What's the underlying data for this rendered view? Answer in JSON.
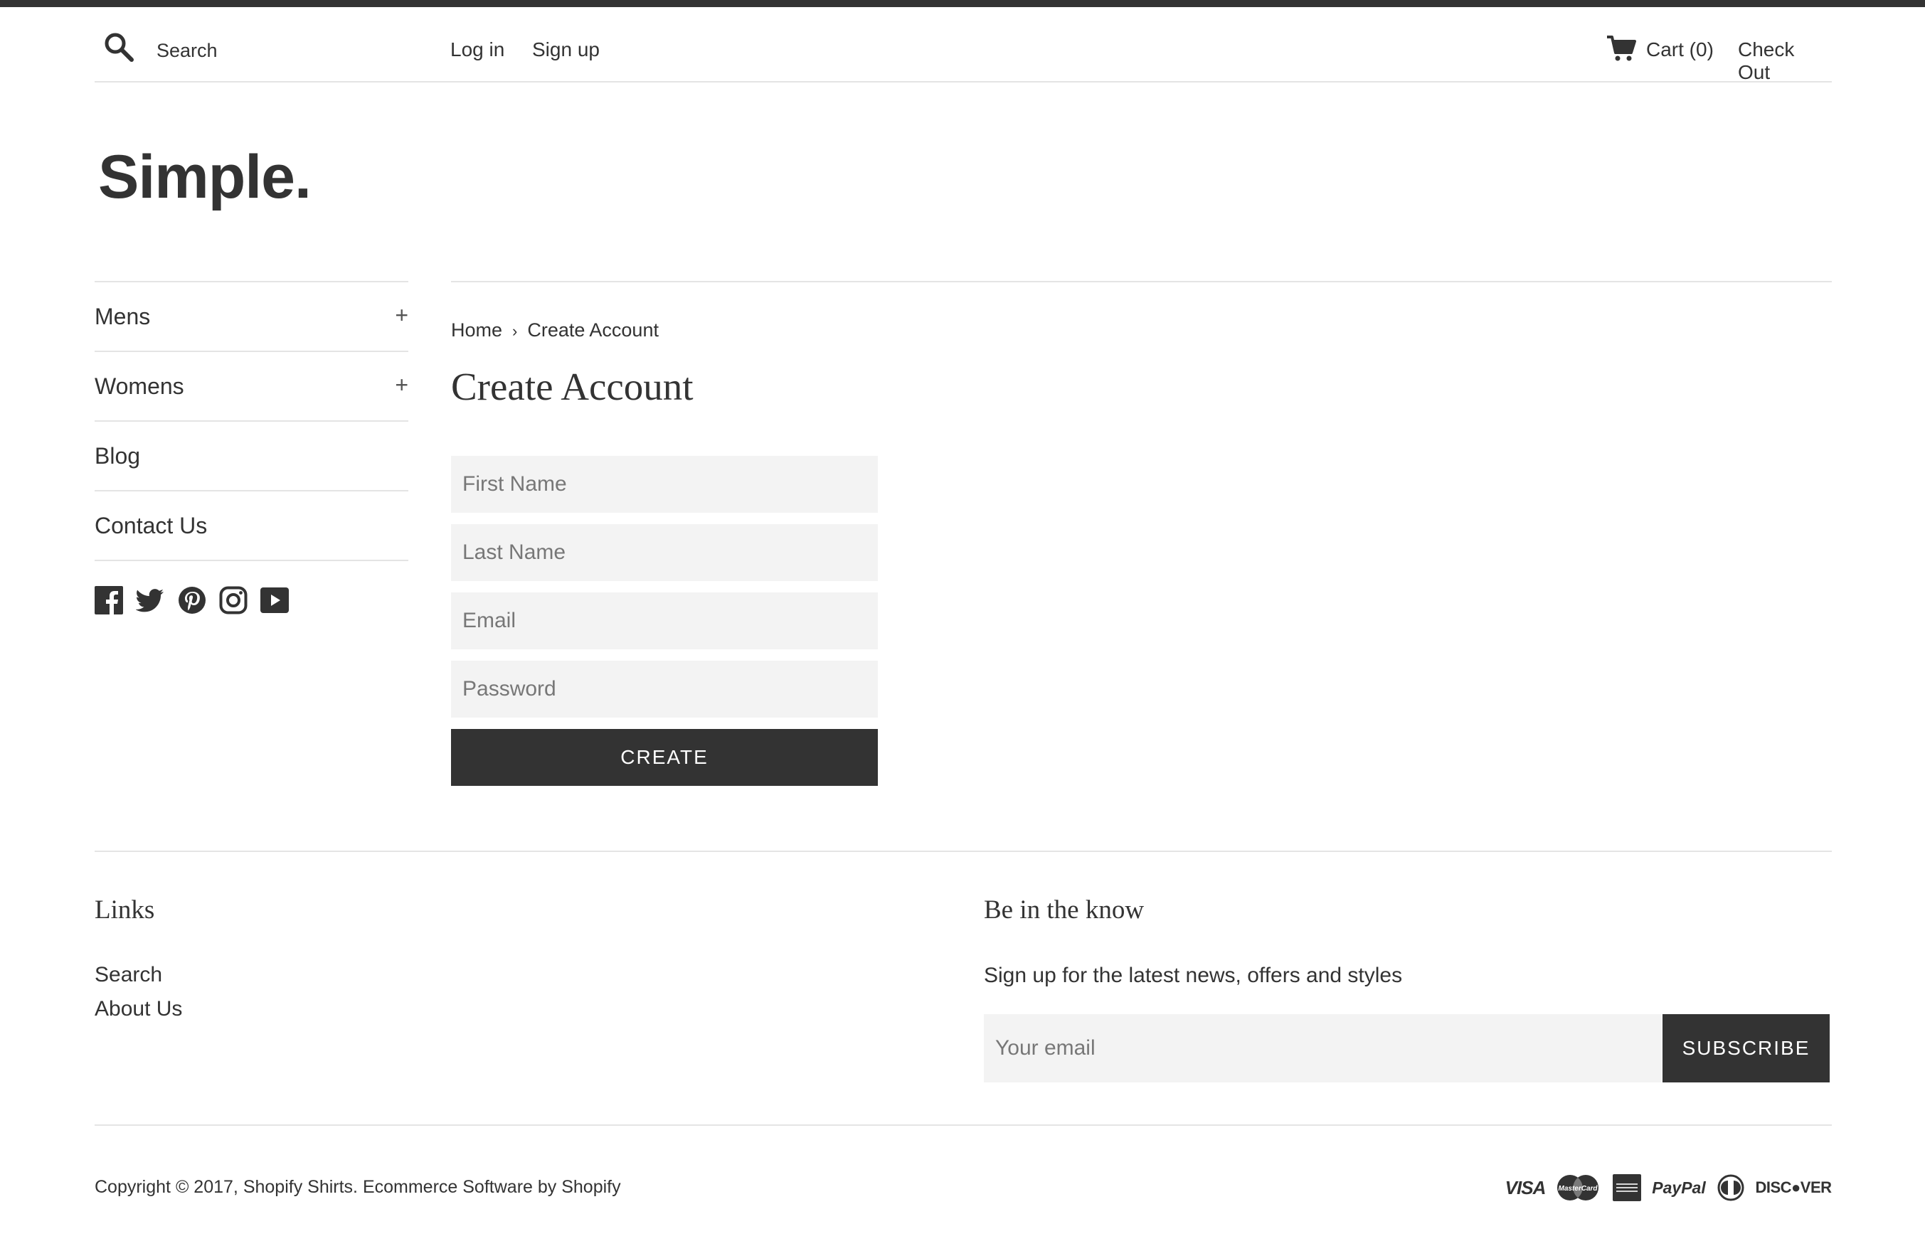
{
  "header": {
    "search_label": "Search",
    "login": "Log in",
    "signup": "Sign up",
    "cart": "Cart (0)",
    "checkout": "Check Out"
  },
  "logo": "Simple.",
  "sidebar": {
    "items": [
      {
        "label": "Mens",
        "expand": "+"
      },
      {
        "label": "Womens",
        "expand": "+"
      },
      {
        "label": "Blog"
      },
      {
        "label": "Contact Us"
      }
    ],
    "social_icons": [
      "facebook-icon",
      "twitter-icon",
      "pinterest-icon",
      "instagram-icon",
      "youtube-icon"
    ]
  },
  "breadcrumb": {
    "home": "Home",
    "separator": "›",
    "current": "Create Account"
  },
  "form": {
    "title": "Create Account",
    "first_name_placeholder": "First Name",
    "last_name_placeholder": "Last Name",
    "email_placeholder": "Email",
    "password_placeholder": "Password",
    "submit": "CREATE"
  },
  "footer": {
    "links_title": "Links",
    "links": [
      "Search",
      "About Us"
    ],
    "newsletter_title": "Be in the know",
    "newsletter_text": "Sign up for the latest news, offers and styles",
    "email_placeholder": "Your email",
    "subscribe": "SUBSCRIBE",
    "copyright": "Copyright © 2017, Shopify Shirts.",
    "powered_by": "Ecommerce Software by Shopify",
    "payment": {
      "visa": "VISA",
      "mastercard": "MasterCard",
      "amex": "AMERICAN EXPRESS",
      "paypal": "PayPal",
      "discover": "DISC●VER"
    }
  },
  "colors": {
    "text": "#333333",
    "topbar": "#333333",
    "border": "#e4e4e4",
    "input_bg": "#f3f3f3",
    "button_bg": "#333333",
    "button_text": "#ffffff"
  }
}
